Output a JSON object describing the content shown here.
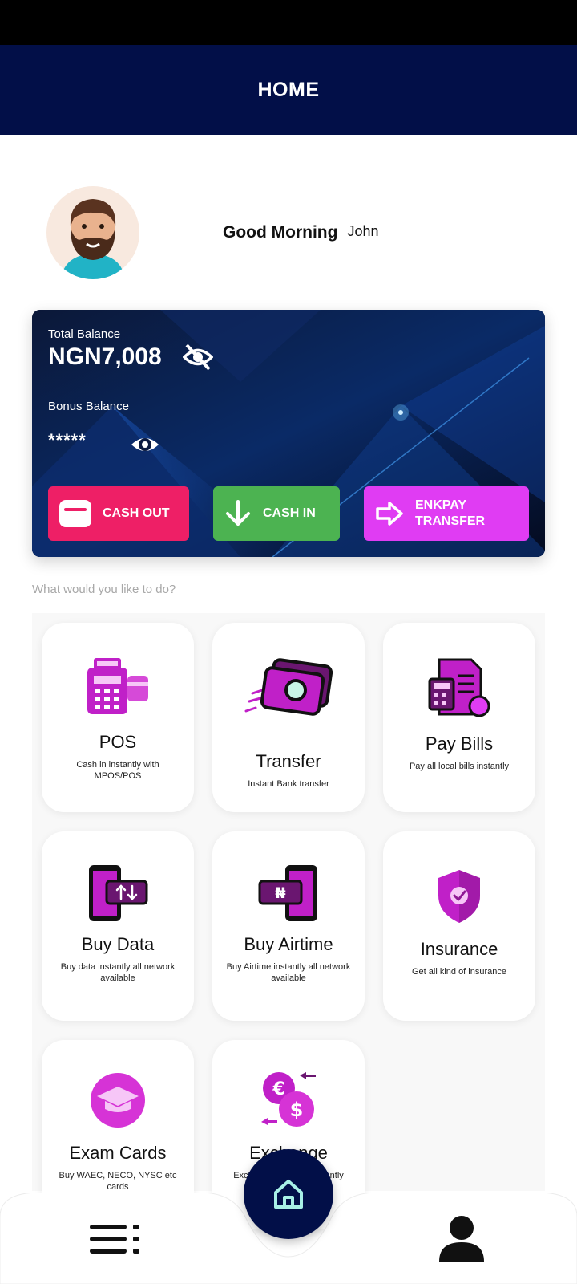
{
  "header": {
    "title": "HOME"
  },
  "greeting": {
    "text": "Good Morning",
    "name": "John"
  },
  "balance": {
    "total_label": "Total Balance",
    "total_amount": "NGN7,008",
    "bonus_label": "Bonus Balance",
    "bonus_mask": "*****"
  },
  "actions": {
    "cash_out": "CASH OUT",
    "cash_in": "CASH IN",
    "enkpay_line1": "ENKPAY",
    "enkpay_line2": "TRANSFER"
  },
  "prompt": "What would you like to do?",
  "services": [
    {
      "title": "POS",
      "desc": "Cash in instantly with MPOS/POS"
    },
    {
      "title": "Transfer",
      "desc": "Instant Bank transfer"
    },
    {
      "title": "Pay Bills",
      "desc": "Pay all local bills instantly"
    },
    {
      "title": "Buy Data",
      "desc": "Buy data instantly all network available"
    },
    {
      "title": "Buy Airtime",
      "desc": "Buy Airtime instantly all network available"
    },
    {
      "title": "Insurance",
      "desc": "Get all kind of insurance"
    },
    {
      "title": "Exam Cards",
      "desc": "Buy WAEC, NECO, NYSC etc cards"
    },
    {
      "title": "Exchange",
      "desc": "Exchange currency instantly"
    }
  ],
  "colors": {
    "header_bg": "#020f48",
    "cash_out": "#ee1f66",
    "cash_in": "#4cb351",
    "enkpay": "#e03cf3",
    "icon_purple": "#c020c8"
  },
  "icons": {
    "eye_hidden": "eye-slash-icon",
    "eye": "eye-icon",
    "home": "home-icon",
    "menu": "menu-icon",
    "profile": "user-icon"
  }
}
